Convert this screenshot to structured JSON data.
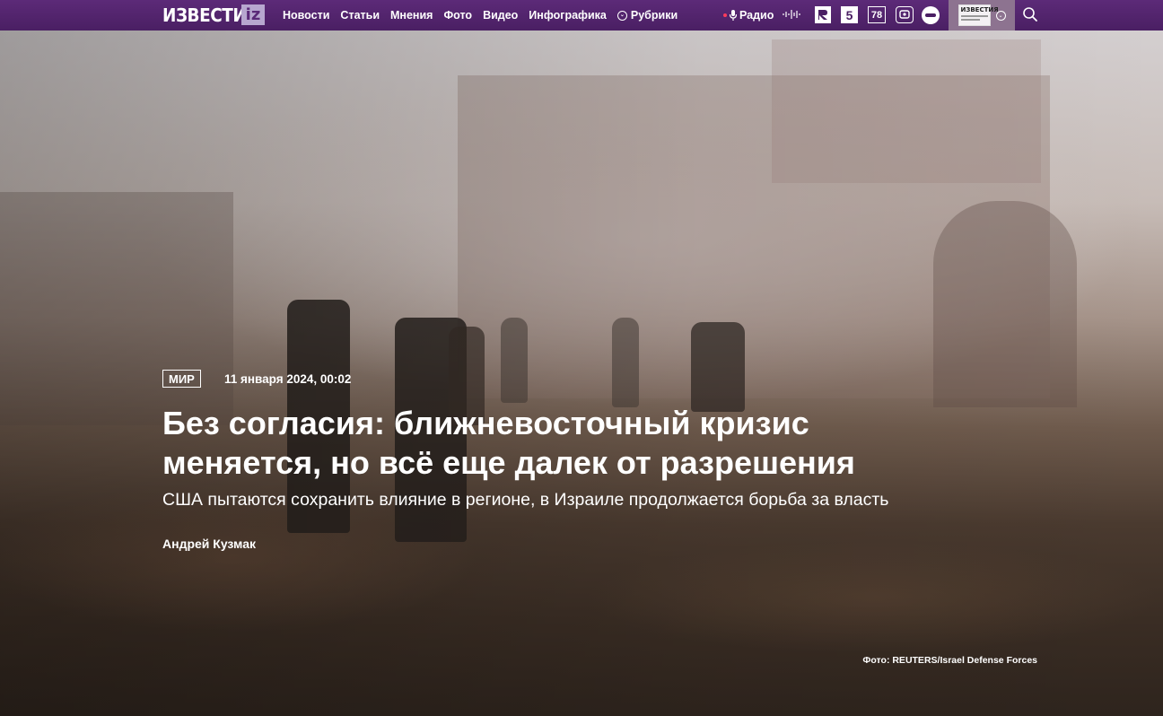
{
  "header": {
    "logo_text": "ИЗВЕСТИЯ",
    "logo_badge": "iz",
    "nav": [
      {
        "label": "Новости"
      },
      {
        "label": "Статьи"
      },
      {
        "label": "Мнения"
      },
      {
        "label": "Фото"
      },
      {
        "label": "Видео"
      },
      {
        "label": "Инфографика"
      },
      {
        "label": "Рубрики"
      }
    ],
    "radio_label": "Радио",
    "partners": [
      "5",
      "78"
    ],
    "newspaper_label": "ИЗВЕСТИЯ"
  },
  "article": {
    "rubric": "МИР",
    "date": "11 января 2024, 00:02",
    "title": "Без согласия: ближневосточный кризис меняется, но всё еще далек от разрешения",
    "subtitle": "США пытаются сохранить влияние в регионе, в Израиле продолжается борьба за власть",
    "author": "Андрей Кузмак",
    "photo_credit": "Фото: REUTERS/Israel Defense Forces"
  },
  "colors": {
    "header_bg": "#4f2169",
    "header_accent": "#8d7390",
    "live_dot": "#ff3b5b"
  }
}
